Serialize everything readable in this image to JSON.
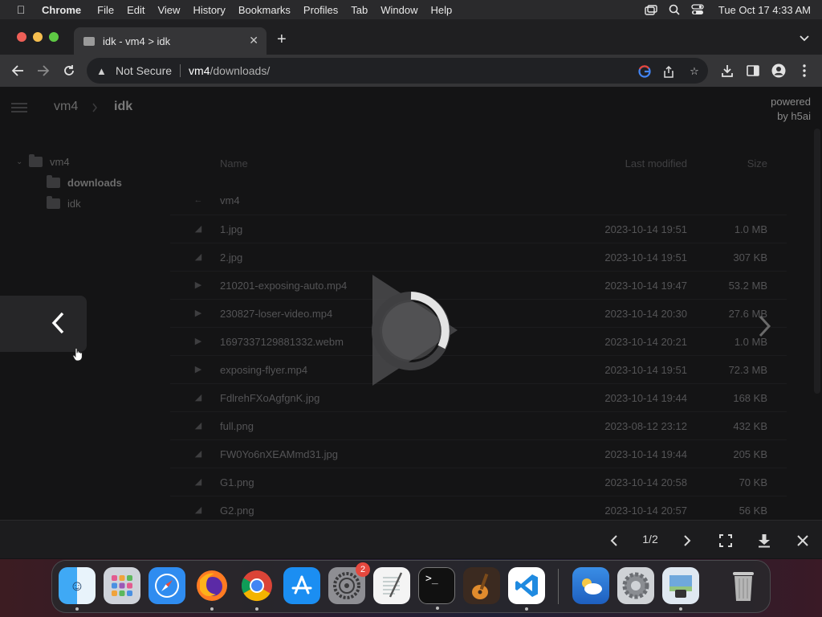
{
  "menubar": {
    "app": "Chrome",
    "items": [
      "File",
      "Edit",
      "View",
      "History",
      "Bookmarks",
      "Profiles",
      "Tab",
      "Window",
      "Help"
    ],
    "clock": "Tue Oct 17  4:33 AM"
  },
  "tab": {
    "title": "idk - vm4 > idk"
  },
  "omnibox": {
    "security": "Not Secure",
    "host": "vm4",
    "path": "/downloads/"
  },
  "breadcrumb": {
    "root": "vm4",
    "current": "idk"
  },
  "powered": {
    "line1": "powered",
    "line2": "by h5ai"
  },
  "tree": {
    "root": "vm4",
    "children": [
      "downloads",
      "idk"
    ]
  },
  "listing": {
    "headers": {
      "name": "Name",
      "modified": "Last modified",
      "size": "Size"
    },
    "parent": "vm4",
    "rows": [
      {
        "icon": "image-icon",
        "name": "1.jpg",
        "date": "2023-10-14 19:51",
        "size": "1.0 MB"
      },
      {
        "icon": "image-icon",
        "name": "2.jpg",
        "date": "2023-10-14 19:51",
        "size": "307 KB"
      },
      {
        "icon": "video-icon",
        "name": "210201-exposing-auto.mp4",
        "date": "2023-10-14 19:47",
        "size": "53.2 MB"
      },
      {
        "icon": "video-icon",
        "name": "230827-loser-video.mp4",
        "date": "2023-10-14 20:30",
        "size": "27.6 MB"
      },
      {
        "icon": "video-icon",
        "name": "1697337129881332.webm",
        "date": "2023-10-14 20:21",
        "size": "1.0 MB"
      },
      {
        "icon": "video-icon",
        "name": "exposing-flyer.mp4",
        "date": "2023-10-14 19:51",
        "size": "72.3 MB"
      },
      {
        "icon": "image-icon",
        "name": "FdlrehFXoAgfgnK.jpg",
        "date": "2023-10-14 19:44",
        "size": "168 KB"
      },
      {
        "icon": "image-icon",
        "name": "full.png",
        "date": "2023-08-12 23:12",
        "size": "432 KB"
      },
      {
        "icon": "image-icon",
        "name": "FW0Yo6nXEAMmd31.jpg",
        "date": "2023-10-14 19:44",
        "size": "205 KB"
      },
      {
        "icon": "image-icon",
        "name": "G1.png",
        "date": "2023-10-14 20:58",
        "size": "70 KB"
      },
      {
        "icon": "image-icon",
        "name": "G2.png",
        "date": "2023-10-14 20:57",
        "size": "56 KB"
      }
    ]
  },
  "viewer": {
    "page": "1/2"
  },
  "dock": {
    "apps": [
      "Finder",
      "Launchpad",
      "Safari",
      "Firefox",
      "Chrome",
      "App Store",
      "System Settings",
      "TextEdit",
      "Terminal",
      "GarageBand",
      "Visual Studio Code",
      "Weather",
      "System Preferences",
      "Preview",
      "Trash"
    ],
    "settings_badge": "2"
  },
  "colors": {
    "accent_red": "#e5483e",
    "page_bg": "#141415"
  }
}
